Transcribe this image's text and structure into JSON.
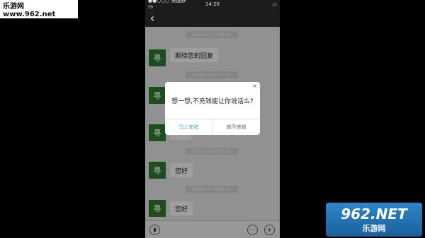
{
  "watermark": {
    "text": "乐游网 www.962.net"
  },
  "status_bar": {
    "carrier": "●●○○○ 美国移动 ",
    "time": "14:26",
    "battery": ""
  },
  "nav": {
    "back_label": "‹",
    "title": ""
  },
  "chat": {
    "items": [
      {
        "type": "time",
        "text": "2018 11 07 08:59"
      },
      {
        "type": "message",
        "avatar": "寻",
        "text": "期待您的回复"
      },
      {
        "type": "time",
        "text": "2018 11 07 11:13"
      },
      {
        "type": "message",
        "avatar": "寻",
        "text": ""
      },
      {
        "type": "message",
        "avatar": "寻",
        "text": ""
      },
      {
        "type": "time",
        "text": "2018 11 08 08:59"
      },
      {
        "type": "message",
        "avatar": "寻",
        "text": "您好"
      },
      {
        "type": "time",
        "text": "2018 11 08 10:24"
      },
      {
        "type": "message",
        "avatar": "寻",
        "text": "您好"
      }
    ]
  },
  "input_bar": {
    "voice_icon": "voice-icon",
    "emoji_icon": "emoji-icon",
    "plus_icon": "plus-icon"
  },
  "dialog": {
    "close": "×",
    "message": "想一想,不充钱能让你说话么?",
    "primary_button": "马上充钱",
    "secondary_button": "就不充钱"
  },
  "logo": {
    "top": "962.NET",
    "bottom": "乐游网"
  }
}
